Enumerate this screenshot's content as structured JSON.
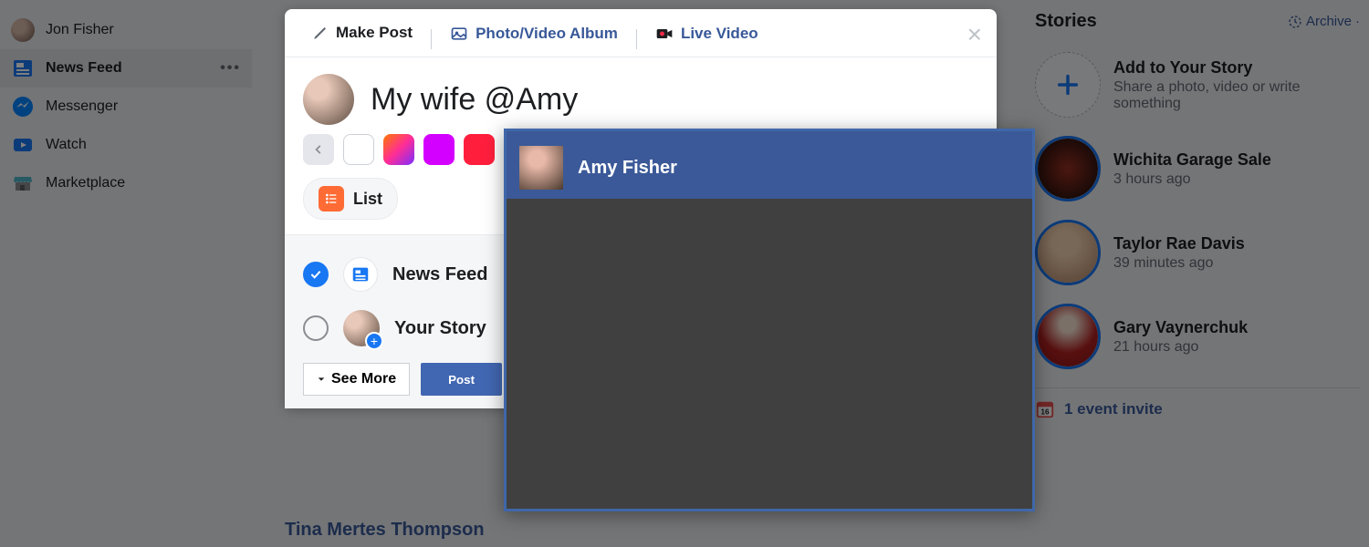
{
  "leftNav": {
    "userName": "Jon Fisher",
    "items": [
      {
        "label": "News Feed",
        "icon": "news-feed-icon",
        "active": true
      },
      {
        "label": "Messenger",
        "icon": "messenger-icon"
      },
      {
        "label": "Watch",
        "icon": "watch-icon"
      },
      {
        "label": "Marketplace",
        "icon": "marketplace-icon"
      }
    ]
  },
  "composer": {
    "tabs": {
      "makePost": "Make Post",
      "photoVideo": "Photo/Video Album",
      "liveVideo": "Live Video"
    },
    "inputValue": "My wife @Amy",
    "listChip": "List",
    "destinations": {
      "newsFeed": "News Feed",
      "yourStory": "Your Story"
    },
    "seeMore": "See More",
    "postButton": "Post"
  },
  "mention": {
    "suggestion": "Amy Fisher"
  },
  "rightCol": {
    "storiesHeader": "Stories",
    "archive": "Archive",
    "addStory": {
      "title": "Add to Your Story",
      "sub": "Share a photo, video or write something"
    },
    "stories": [
      {
        "title": "Wichita Garage Sale",
        "sub": "3 hours ago",
        "bg": "radial-gradient(circle at 50% 50%, #8a2a1e 10%, #1a0e0a 90%)"
      },
      {
        "title": "Taylor Rae Davis",
        "sub": "39 minutes ago",
        "bg": "radial-gradient(circle at 45% 35%, #f0d0b0 25%, #b08060 100%)"
      },
      {
        "title": "Gary Vaynerchuk",
        "sub": "21 hours ago",
        "bg": "radial-gradient(circle at 50% 30%, #f5e0d0 15%, #b02020 55%, #8a1515 100%)"
      }
    ],
    "eventInvite": "1 event invite"
  },
  "feedBelow": "Tina Mertes Thompson"
}
